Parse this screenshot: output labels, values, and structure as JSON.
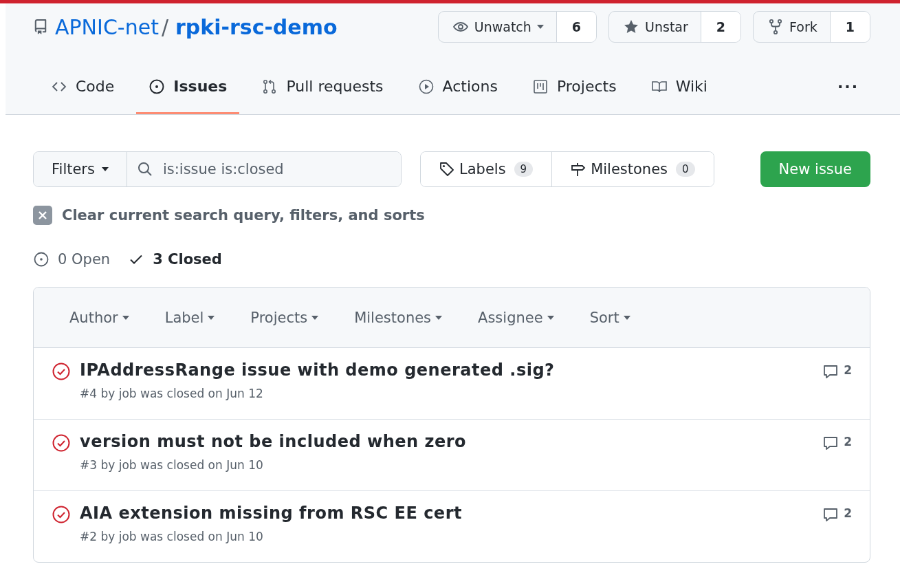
{
  "repo": {
    "owner": "APNIC-net",
    "separator": "/",
    "name": "rpki-rsc-demo"
  },
  "repo_actions": [
    {
      "kind": "watch",
      "label": "Unwatch",
      "count": "6"
    },
    {
      "kind": "star",
      "label": "Unstar",
      "count": "2"
    },
    {
      "kind": "fork",
      "label": "Fork",
      "count": "1"
    }
  ],
  "tabs": [
    {
      "kind": "code",
      "label": "Code",
      "selected": false
    },
    {
      "kind": "issues",
      "label": "Issues",
      "selected": true
    },
    {
      "kind": "pulls",
      "label": "Pull requests",
      "selected": false
    },
    {
      "kind": "actions",
      "label": "Actions",
      "selected": false
    },
    {
      "kind": "projects",
      "label": "Projects",
      "selected": false
    },
    {
      "kind": "wiki",
      "label": "Wiki",
      "selected": false
    },
    {
      "kind": "more",
      "label": "···",
      "selected": false
    }
  ],
  "filters_button": "Filters",
  "search": {
    "value": "is:issue is:closed"
  },
  "labels": {
    "label": "Labels",
    "count": "9"
  },
  "milestones": {
    "label": "Milestones",
    "count": "0"
  },
  "new_issue": "New issue",
  "clear_query": "Clear current search query, filters, and sorts",
  "state_toggles": [
    {
      "kind": "open",
      "label": "0 Open",
      "selected": false
    },
    {
      "kind": "closed",
      "label": "3 Closed",
      "selected": true
    }
  ],
  "table_filters": [
    "Author",
    "Label",
    "Projects",
    "Milestones",
    "Assignee",
    "Sort"
  ],
  "issues": [
    {
      "title": "IPAddressRange issue with demo generated .sig?",
      "meta": "#4 by job was closed on Jun 12",
      "comments": "2",
      "closed": true
    },
    {
      "title": "version must not be included when zero",
      "meta": "#3 by job was closed on Jun 10",
      "comments": "2",
      "closed": true
    },
    {
      "title": "AIA extension missing from RSC EE cert",
      "meta": "#2 by job was closed on Jun 10",
      "comments": "2",
      "closed": true
    }
  ]
}
